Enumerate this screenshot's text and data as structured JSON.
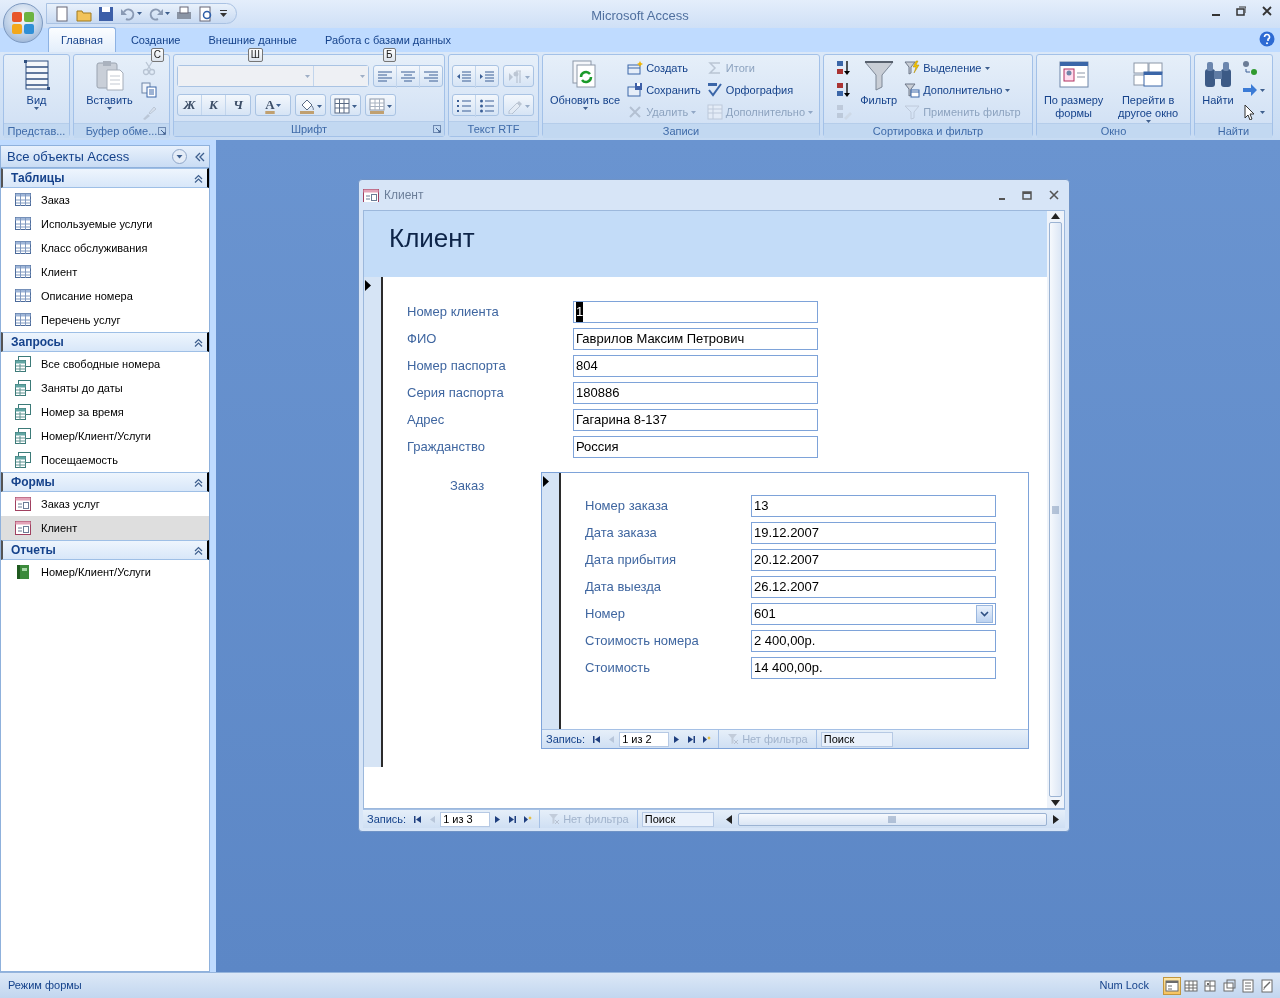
{
  "window": {
    "title": "Microsoft Access"
  },
  "tabs": [
    {
      "label": "Главная",
      "selected": true
    },
    {
      "label": "Создание",
      "selected": false,
      "keytip": "С"
    },
    {
      "label": "Внешние данные",
      "selected": false,
      "keytip": "Ш"
    },
    {
      "label": "Работа с базами данных",
      "selected": false,
      "keytip": "Б"
    }
  ],
  "ribbon": {
    "groups": [
      {
        "name": "Представ...",
        "kind": "stack",
        "launcher": false,
        "columns": [
          [
            {
              "kind": "large",
              "label": "Вид",
              "dropdown": true,
              "disabled": false
            }
          ]
        ]
      },
      {
        "name": "Буфер обме...",
        "kind": "stack",
        "launcher": true,
        "columns": [
          [
            {
              "kind": "large",
              "label": "Вставить",
              "dropdown": true,
              "disabled": false
            }
          ],
          [
            {
              "kind": "icon",
              "dropdown": false,
              "disabled": true
            },
            {
              "kind": "icon",
              "dropdown": false,
              "disabled": false
            },
            {
              "kind": "icon",
              "dropdown": false,
              "disabled": true
            }
          ]
        ]
      },
      {
        "name": "Шрифт",
        "kind": "toolbar",
        "launcher": true,
        "rows": [
          [
            [
              {
                "kind": "combo",
                "dropdown": true,
                "disabled": true
              },
              {
                "kind": "combo",
                "dropdown": true,
                "disabled": true
              }
            ],
            [
              {
                "kind": "icon",
                "dropdown": false,
                "disabled": false
              },
              {
                "kind": "icon",
                "dropdown": false,
                "disabled": false
              },
              {
                "kind": "icon",
                "dropdown": false,
                "disabled": false
              }
            ]
          ],
          [
            [
              {
                "kind": "glyph",
                "label": "Ж",
                "dropdown": false,
                "disabled": false
              },
              {
                "kind": "glyph",
                "label": "К",
                "dropdown": false,
                "disabled": false
              },
              {
                "kind": "glyph",
                "label": "Ч",
                "dropdown": false,
                "disabled": false
              }
            ],
            [
              {
                "kind": "glyph",
                "label": "A",
                "dropdown": true,
                "disabled": false
              }
            ],
            [
              {
                "kind": "icon",
                "dropdown": true,
                "disabled": false
              }
            ],
            [
              {
                "kind": "icon",
                "dropdown": true,
                "disabled": false
              }
            ],
            [
              {
                "kind": "icon",
                "dropdown": true,
                "disabled": false
              }
            ]
          ]
        ]
      },
      {
        "name": "Текст RTF",
        "kind": "toolbar",
        "launcher": false,
        "rows": [
          [
            [
              {
                "kind": "icon",
                "dropdown": false,
                "disabled": false
              },
              {
                "kind": "icon",
                "dropdown": false,
                "disabled": false
              }
            ],
            [
              {
                "kind": "icon",
                "dropdown": true,
                "disabled": true
              }
            ]
          ],
          [
            [
              {
                "kind": "icon",
                "dropdown": false,
                "disabled": false
              },
              {
                "kind": "icon",
                "dropdown": false,
                "disabled": false
              }
            ],
            [
              {
                "kind": "icon",
                "dropdown": true,
                "disabled": true
              }
            ]
          ]
        ]
      },
      {
        "name": "Записи",
        "kind": "stack",
        "launcher": false,
        "columns": [
          [
            {
              "kind": "large",
              "label": "Обновить все",
              "dropdown": true,
              "disabled": false
            }
          ],
          [
            {
              "kind": "small",
              "label": "Создать",
              "dropdown": false,
              "disabled": false
            },
            {
              "kind": "small",
              "label": "Сохранить",
              "dropdown": false,
              "disabled": false
            },
            {
              "kind": "small",
              "label": "Удалить",
              "dropdown": true,
              "disabled": true
            }
          ],
          [
            {
              "kind": "small",
              "label": "Итоги",
              "dropdown": false,
              "disabled": true
            },
            {
              "kind": "small",
              "label": "Орфография",
              "dropdown": false,
              "disabled": false
            },
            {
              "kind": "small",
              "label": "Дополнительно",
              "dropdown": true,
              "disabled": true
            }
          ]
        ]
      },
      {
        "name": "Сортировка и фильтр",
        "kind": "stack",
        "launcher": false,
        "columns": [
          [
            {
              "kind": "icon",
              "dropdown": false,
              "disabled": false
            },
            {
              "kind": "icon",
              "dropdown": false,
              "disabled": false
            },
            {
              "kind": "icon",
              "dropdown": false,
              "disabled": true
            }
          ],
          [
            {
              "kind": "large",
              "label": "Фильтр",
              "dropdown": false,
              "disabled": false
            }
          ],
          [
            {
              "kind": "small",
              "label": "Выделение",
              "dropdown": true,
              "disabled": false
            },
            {
              "kind": "small",
              "label": "Дополнительно",
              "dropdown": true,
              "disabled": false
            },
            {
              "kind": "small",
              "label": "Применить фильтр",
              "dropdown": false,
              "disabled": true
            }
          ]
        ]
      },
      {
        "name": "Окно",
        "kind": "stack",
        "launcher": false,
        "columns": [
          [
            {
              "kind": "large",
              "label": "По размеру формы",
              "dropdown": false,
              "disabled": false
            }
          ],
          [
            {
              "kind": "large",
              "label": "Перейти в другое окно",
              "dropdown": true,
              "disabled": false
            }
          ]
        ]
      },
      {
        "name": "Найти",
        "kind": "stack",
        "launcher": false,
        "columns": [
          [
            {
              "kind": "large",
              "label": "Найти",
              "dropdown": false,
              "disabled": false
            }
          ],
          [
            {
              "kind": "icon",
              "dropdown": false,
              "disabled": false
            },
            {
              "kind": "icon",
              "dropdown": true,
              "disabled": false
            },
            {
              "kind": "icon",
              "dropdown": true,
              "disabled": false
            }
          ]
        ]
      }
    ]
  },
  "nav_pane": {
    "title": "Все объекты Access",
    "groups": [
      {
        "title": "Таблицы",
        "expanded": true,
        "items": [
          {
            "label": "Заказ",
            "kind": "table",
            "selected": false
          },
          {
            "label": "Используемые услуги",
            "kind": "table",
            "selected": false
          },
          {
            "label": "Класс обслуживания",
            "kind": "table",
            "selected": false
          },
          {
            "label": "Клиент",
            "kind": "table",
            "selected": false
          },
          {
            "label": "Описание номера",
            "kind": "table",
            "selected": false
          },
          {
            "label": "Перечень услуг",
            "kind": "table",
            "selected": false
          }
        ]
      },
      {
        "title": "Запросы",
        "expanded": true,
        "items": [
          {
            "label": "Все свободные номера",
            "kind": "query",
            "selected": false
          },
          {
            "label": "Заняты до даты",
            "kind": "query",
            "selected": false
          },
          {
            "label": "Номер за время",
            "kind": "query",
            "selected": false
          },
          {
            "label": "Номер/Клиент/Услуги",
            "kind": "query",
            "selected": false
          },
          {
            "label": "Посещаемость",
            "kind": "query",
            "selected": false
          }
        ]
      },
      {
        "title": "Формы",
        "expanded": true,
        "items": [
          {
            "label": "Заказ услуг",
            "kind": "form",
            "selected": false
          },
          {
            "label": "Клиент",
            "kind": "form",
            "selected": true
          }
        ]
      },
      {
        "title": "Отчеты",
        "expanded": true,
        "items": [
          {
            "label": "Номер/Клиент/Услуги",
            "kind": "report",
            "selected": false
          }
        ]
      }
    ]
  },
  "form": {
    "title": "Клиент",
    "header": "Клиент",
    "fields": [
      {
        "label": "Номер клиента",
        "value": "1",
        "kind": "text",
        "selected": true
      },
      {
        "label": "ФИО",
        "value": "Гаврилов Максим Петрович",
        "kind": "text",
        "selected": false
      },
      {
        "label": "Номер паспорта",
        "value": "804",
        "kind": "text",
        "selected": false
      },
      {
        "label": "Серия паспорта",
        "value": "180886",
        "kind": "text",
        "selected": false
      },
      {
        "label": "Адрес",
        "value": "Гагарина 8-137",
        "kind": "text",
        "selected": false
      },
      {
        "label": "Гражданство",
        "value": "Россия",
        "kind": "text",
        "selected": false
      }
    ],
    "subform": {
      "label": "Заказ",
      "fields": [
        {
          "label": "Номер заказа",
          "value": "13",
          "kind": "text",
          "selected": false
        },
        {
          "label": "Дата заказа",
          "value": "19.12.2007",
          "kind": "text",
          "selected": false
        },
        {
          "label": "Дата прибытия",
          "value": "20.12.2007",
          "kind": "text",
          "selected": false
        },
        {
          "label": "Дата выезда",
          "value": "26.12.2007",
          "kind": "text",
          "selected": false
        },
        {
          "label": "Номер",
          "value": "601",
          "kind": "combo",
          "selected": false
        },
        {
          "label": "Стоимость номера",
          "value": "2 400,00р.",
          "kind": "text",
          "selected": false
        },
        {
          "label": "Стоимость",
          "value": "14 400,00р.",
          "kind": "text",
          "selected": false
        }
      ],
      "navigator": {
        "label": "Запись:",
        "position": "1 из 2",
        "filter": "Нет фильтра",
        "search": "Поиск"
      }
    },
    "navigator": {
      "label": "Запись:",
      "position": "1 из 3",
      "filter": "Нет фильтра",
      "search": "Поиск"
    }
  },
  "status_bar": {
    "mode": "Режим формы",
    "indicator": "Num Lock",
    "views": [
      {
        "selected": true
      },
      {
        "selected": false
      },
      {
        "selected": false
      },
      {
        "selected": false
      },
      {
        "selected": false
      },
      {
        "selected": false
      }
    ]
  }
}
